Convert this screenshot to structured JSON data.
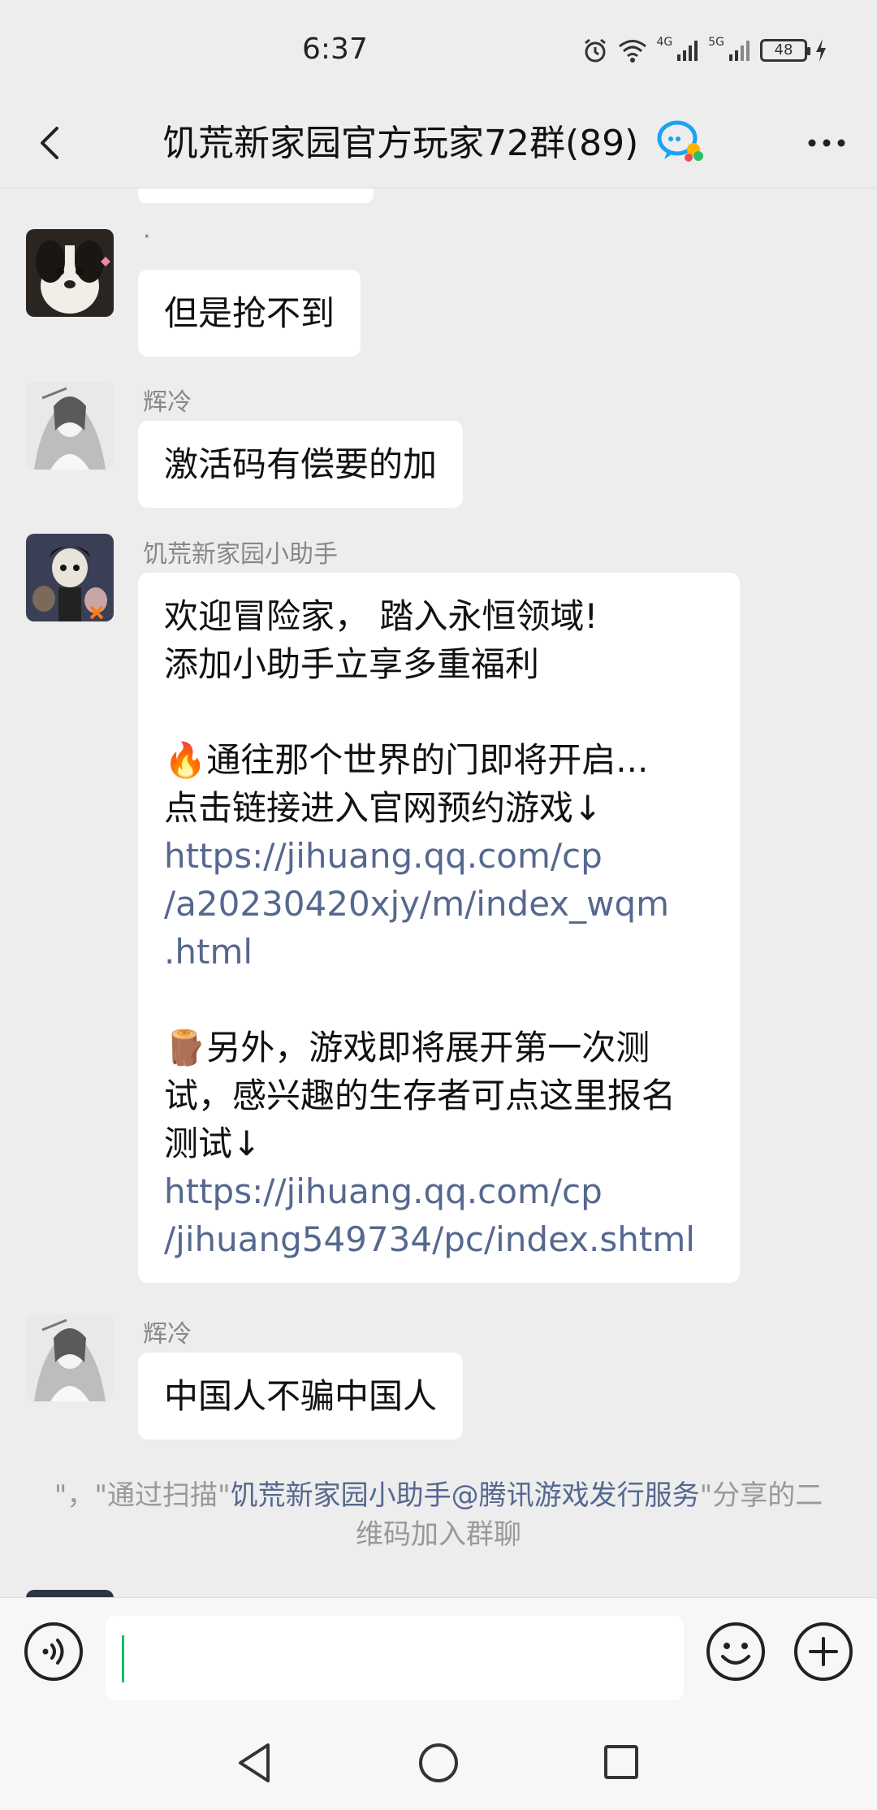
{
  "status_bar": {
    "time": "6:37",
    "net1": "4G",
    "net2": "5G",
    "battery": "48"
  },
  "header": {
    "title": "饥荒新家园官方玩家72群(89)"
  },
  "messages": [
    {
      "sender": "·",
      "avatar": "dog-avatar",
      "lines": [
        "但是抢不到"
      ]
    },
    {
      "sender": "辉冷",
      "avatar": "ink-figure-avatar",
      "lines": [
        "激活码有偿要的加"
      ]
    },
    {
      "sender": "饥荒新家园小助手",
      "avatar": "game-character-avatar",
      "lines": [
        "欢迎冒险家， 踏入永恒领域!",
        "添加小助手立享多重福利",
        "",
        "🔥通往那个世界的门即将开启...",
        "点击链接进入官网预约游戏↓",
        "https://jihuang.qq.com/cp",
        "/a20230420xjy/m/index_wqm",
        ".html",
        "",
        "🪵另外，游戏即将展开第一次测",
        "试，感兴趣的生存者可点这里报名",
        "测试↓",
        "https://jihuang.qq.com/cp",
        "/jihuang549734/pc/index.shtml"
      ]
    },
    {
      "sender": "辉冷",
      "avatar": "ink-figure-avatar",
      "lines": [
        "中国人不骗中国人"
      ]
    }
  ],
  "system_notice": {
    "prefix": "\"，\"通过扫描\"",
    "link": "饥荒新家园小助手@腾讯游戏发行服务",
    "suffix": "\"分享的二维码加入群聊"
  },
  "input": {
    "value": ""
  },
  "icons": {
    "back": "chevron-left-icon",
    "badge": "chat-bubble-icon",
    "more": "more-dots-icon",
    "voice": "voice-icon",
    "emoji": "emoji-icon",
    "plus": "plus-icon",
    "nav_back": "nav-back-icon",
    "nav_home": "nav-home-icon",
    "nav_recent": "nav-recent-icon"
  },
  "colors": {
    "background": "#ededed",
    "bubble": "#ffffff",
    "link": "#55688f",
    "caret": "#07c160"
  }
}
